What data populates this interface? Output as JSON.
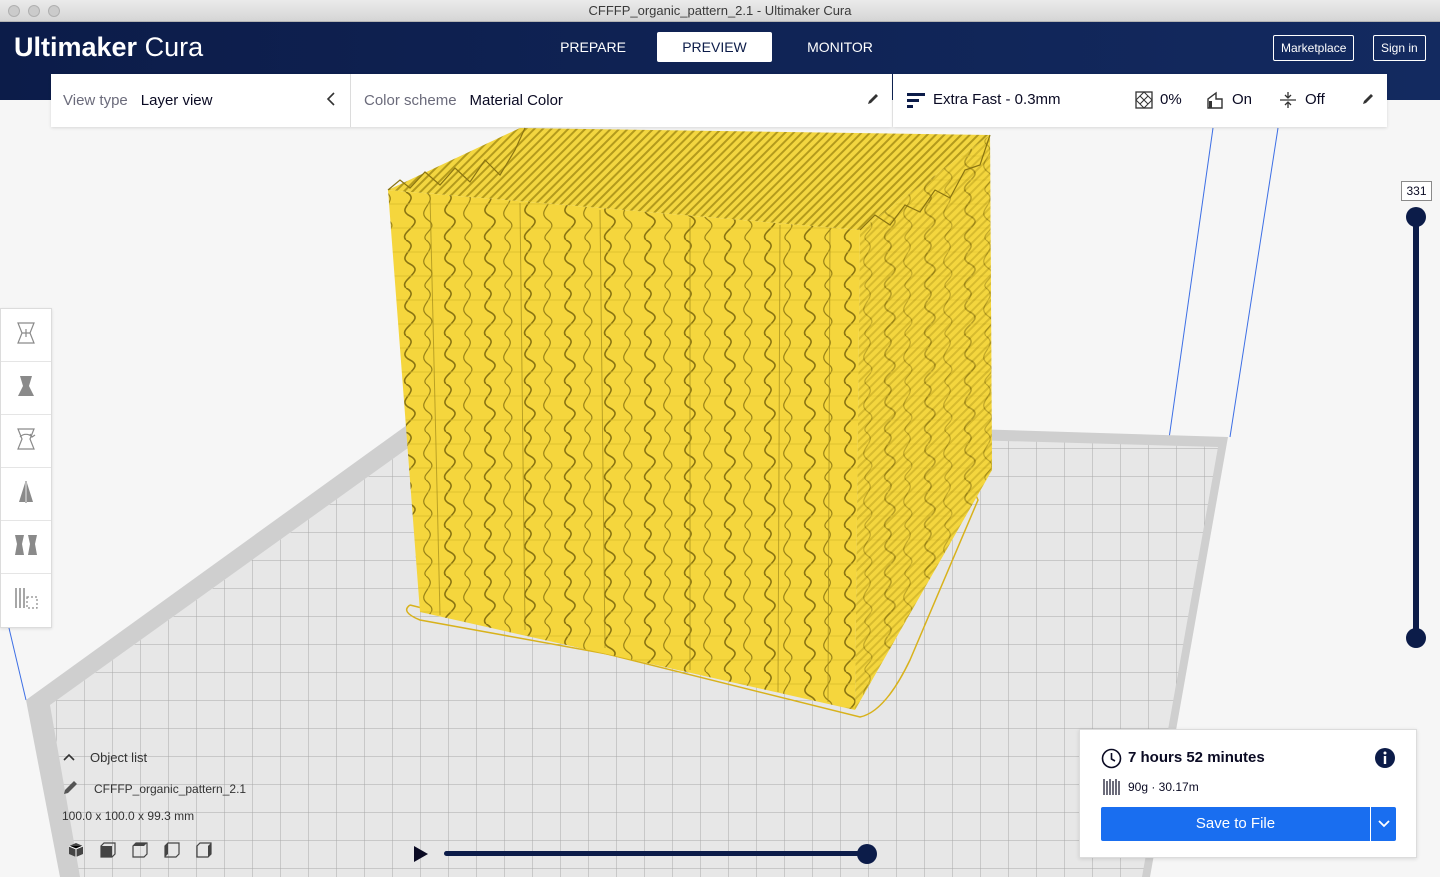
{
  "window": {
    "title": "CFFFP_organic_pattern_2.1 - Ultimaker Cura"
  },
  "header": {
    "logo_brand": "Ultimaker",
    "logo_product": "Cura",
    "tabs": [
      {
        "label": "PREPARE",
        "active": false
      },
      {
        "label": "PREVIEW",
        "active": true
      },
      {
        "label": "MONITOR",
        "active": false
      }
    ],
    "marketplace_label": "Marketplace",
    "signin_label": "Sign in"
  },
  "view_panel": {
    "view_type_label": "View type",
    "view_type_value": "Layer view",
    "color_scheme_label": "Color scheme",
    "color_scheme_value": "Material Color"
  },
  "print_settings": {
    "profile": "Extra Fast - 0.3mm",
    "infill": "0%",
    "support": "On",
    "adhesion": "Off"
  },
  "tools": [
    "move-tool",
    "scale-tool",
    "rotate-tool",
    "mirror-tool",
    "per-model-settings-tool",
    "support-blocker-tool"
  ],
  "layer_slider": {
    "current_layer": "331"
  },
  "object_list": {
    "header": "Object list",
    "object_name": "CFFFP_organic_pattern_2.1",
    "dimensions": "100.0 x 100.0 x 99.3 mm"
  },
  "print_summary": {
    "time": "7 hours 52 minutes",
    "material": "90g · 30.17m",
    "save_label": "Save to File"
  },
  "colors": {
    "header_bg": "#0c1c49",
    "accent_blue": "#196ef0",
    "model_yellow": "#f5d63d"
  }
}
